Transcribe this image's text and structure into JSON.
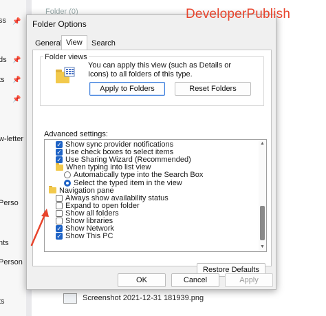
{
  "background": {
    "left_fragments": [
      "ss",
      "ds",
      "ts",
      "w-letter",
      "Perso",
      "nts",
      "Person",
      "ts"
    ],
    "top_item": "Folder (0)",
    "file_name": "Screenshot 2021-12-31 181939.png"
  },
  "watermark": "DeveloperPublish",
  "dialog": {
    "title": "Folder Options",
    "tabs": [
      "General",
      "View",
      "Search"
    ],
    "active_tab": "View",
    "folder_views": {
      "label": "Folder views",
      "description": "You can apply this view (such as Details or Icons) to all folders of this type.",
      "apply_button": "Apply to Folders",
      "reset_button": "Reset Folders"
    },
    "advanced": {
      "label": "Advanced settings:",
      "items": [
        {
          "type": "checkbox",
          "checked": true,
          "indent": 0,
          "label": "Show sync provider notifications"
        },
        {
          "type": "checkbox",
          "checked": true,
          "indent": 0,
          "label": "Use check boxes to select items"
        },
        {
          "type": "checkbox",
          "checked": true,
          "indent": 0,
          "label": "Use Sharing Wizard (Recommended)"
        },
        {
          "type": "folder",
          "indent": 0,
          "label": "When typing into list view"
        },
        {
          "type": "radio",
          "checked": false,
          "indent": 1,
          "label": "Automatically type into the Search Box"
        },
        {
          "type": "radio",
          "checked": true,
          "indent": 1,
          "label": "Select the typed item in the view"
        },
        {
          "type": "folder",
          "indent": -1,
          "label": "Navigation pane"
        },
        {
          "type": "checkbox",
          "checked": false,
          "indent": 0,
          "label": "Always show availability status"
        },
        {
          "type": "checkbox",
          "checked": false,
          "indent": 0,
          "label": "Expand to open folder"
        },
        {
          "type": "checkbox",
          "checked": false,
          "indent": 0,
          "label": "Show all folders",
          "highlighted": true
        },
        {
          "type": "checkbox",
          "checked": false,
          "indent": 0,
          "label": "Show libraries"
        },
        {
          "type": "checkbox",
          "checked": true,
          "indent": 0,
          "label": "Show Network"
        },
        {
          "type": "checkbox",
          "checked": true,
          "indent": 0,
          "label": "Show This PC"
        }
      ],
      "restore_button": "Restore Defaults"
    },
    "footer": {
      "ok": "OK",
      "cancel": "Cancel",
      "apply": "Apply"
    }
  },
  "colors": {
    "accent": "#1f63c5",
    "highlight": "#f5a7ad",
    "watermark": "#e8442c",
    "arrow": "#e8442c"
  }
}
